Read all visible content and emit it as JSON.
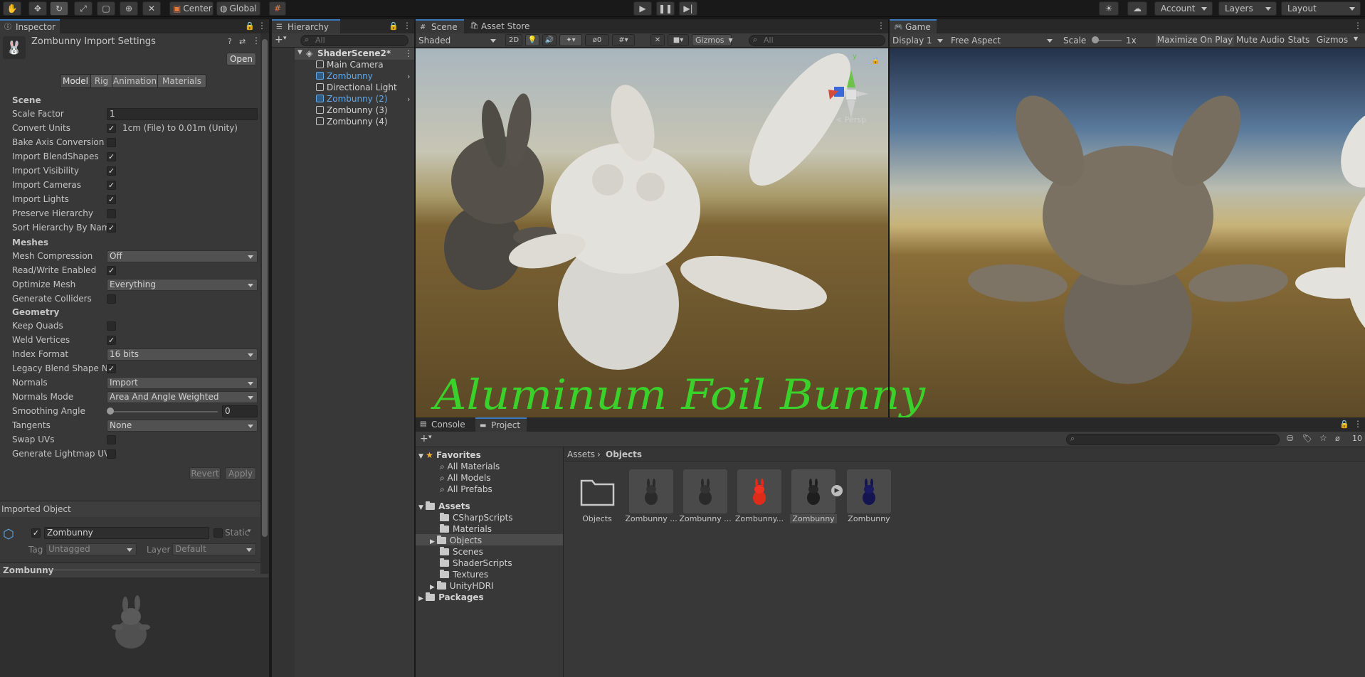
{
  "toolbar": {
    "pivot_label": "Center",
    "space_label": "Global",
    "account_label": "Account",
    "layers_label": "Layers",
    "layout_label": "Layout"
  },
  "inspector": {
    "tab_label": "Inspector",
    "title": "Zombunny Import Settings",
    "open_button": "Open",
    "tabs": [
      "Model",
      "Rig",
      "Animation",
      "Materials"
    ],
    "scene_section": "Scene",
    "scale_factor_label": "Scale Factor",
    "scale_factor_value": "1",
    "convert_units_label": "Convert Units",
    "convert_units_note": "1cm (File) to 0.01m (Unity)",
    "bake_axis_label": "Bake Axis Conversion",
    "import_blendshapes_label": "Import BlendShapes",
    "import_visibility_label": "Import Visibility",
    "import_cameras_label": "Import Cameras",
    "import_lights_label": "Import Lights",
    "preserve_hierarchy_label": "Preserve Hierarchy",
    "sort_hierarchy_label": "Sort Hierarchy By Name",
    "meshes_section": "Meshes",
    "mesh_compression_label": "Mesh Compression",
    "mesh_compression_value": "Off",
    "read_write_label": "Read/Write Enabled",
    "optimize_mesh_label": "Optimize Mesh",
    "optimize_mesh_value": "Everything",
    "generate_colliders_label": "Generate Colliders",
    "geometry_section": "Geometry",
    "keep_quads_label": "Keep Quads",
    "weld_vertices_label": "Weld Vertices",
    "index_format_label": "Index Format",
    "index_format_value": "16 bits",
    "legacy_blend_label": "Legacy Blend Shape Normals",
    "normals_label": "Normals",
    "normals_value": "Import",
    "normals_mode_label": "Normals Mode",
    "normals_mode_value": "Area And Angle Weighted",
    "smoothing_angle_label": "Smoothing Angle",
    "smoothing_angle_value": "0",
    "tangents_label": "Tangents",
    "tangents_value": "None",
    "swap_uvs_label": "Swap UVs",
    "lightmap_uvs_label": "Generate Lightmap UVs",
    "revert_button": "Revert",
    "apply_button": "Apply",
    "imported_object_header": "Imported Object",
    "object_name": "Zombunny",
    "static_label": "Static",
    "tag_label": "Tag",
    "tag_value": "Untagged",
    "layer_label": "Layer",
    "layer_value": "Default",
    "preview_title": "Zombunny"
  },
  "hierarchy": {
    "tab_label": "Hierarchy",
    "search_placeholder": "All",
    "scene_name": "ShaderScene2*",
    "items": [
      "Main Camera",
      "Zombunny",
      "Directional Light",
      "Zombunny (2)",
      "Zombunny (3)",
      "Zombunny (4)"
    ]
  },
  "scene": {
    "tab_label": "Scene",
    "asset_store_tab": "Asset Store",
    "shading_mode": "Shaded",
    "mode_2d": "2D",
    "hidden_count": "0",
    "gizmos_label": "Gizmos",
    "search_placeholder": "All",
    "gizmo_y": "y",
    "persp_label": "< Persp",
    "annotation": "Aluminum Foil Bunny"
  },
  "game": {
    "tab_label": "Game",
    "display": "Display 1",
    "aspect": "Free Aspect",
    "scale_label": "Scale",
    "scale_value": "1x",
    "maximize_on_play": "Maximize On Play",
    "mute_audio": "Mute Audio",
    "stats": "Stats",
    "gizmos": "Gizmos"
  },
  "project": {
    "console_tab": "Console",
    "project_tab": "Project",
    "hidden_count": "10",
    "favorites_label": "Favorites",
    "favorites": [
      "All Materials",
      "All Models",
      "All Prefabs"
    ],
    "assets_label": "Assets",
    "asset_folders": [
      "CSharpScripts",
      "Materials",
      "Objects",
      "Scenes",
      "ShaderScripts",
      "Textures",
      "UnityHDRI"
    ],
    "packages_label": "Packages",
    "breadcrumb_root": "Assets",
    "breadcrumb_current": "Objects",
    "assets": [
      {
        "label": "Objects"
      },
      {
        "label": "Zombunny ..."
      },
      {
        "label": "Zombunny ..."
      },
      {
        "label": "Zombunny..."
      },
      {
        "label": "Zombunny"
      },
      {
        "label": "Zombunny"
      }
    ]
  },
  "colors": {
    "accent": "#3a79bb",
    "annotation": "#39d12a",
    "selected_row": "#2c5d87"
  }
}
